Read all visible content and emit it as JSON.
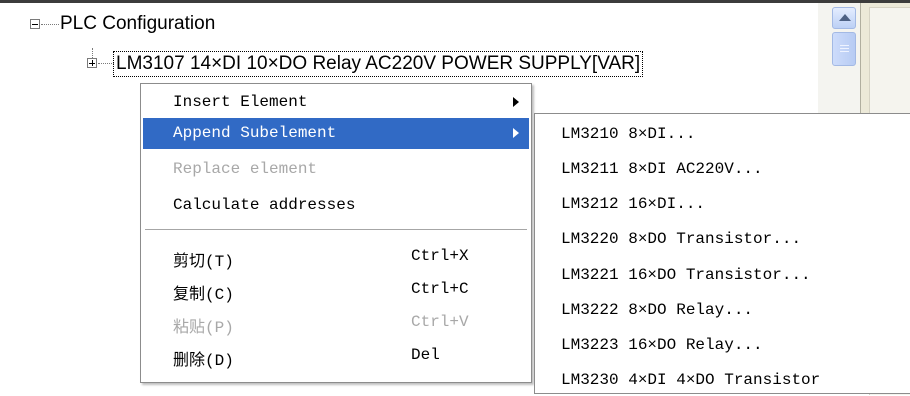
{
  "tree": {
    "root_label": "PLC Configuration",
    "child_label": "LM3107 14×DI 10×DO Relay AC220V POWER SUPPLY[VAR]"
  },
  "context_menu": {
    "items": [
      {
        "label": "Insert Element",
        "submenu": true,
        "state": "normal"
      },
      {
        "label": "Append Subelement",
        "submenu": true,
        "state": "highlighted"
      },
      {
        "label": "Replace element",
        "submenu": false,
        "state": "disabled"
      },
      {
        "label": "Calculate addresses",
        "submenu": false,
        "state": "normal"
      },
      {
        "label": "剪切(T)",
        "shortcut": "Ctrl+X",
        "state": "normal"
      },
      {
        "label": "复制(C)",
        "shortcut": "Ctrl+C",
        "state": "normal"
      },
      {
        "label": "粘贴(P)",
        "shortcut": "Ctrl+V",
        "state": "disabled"
      },
      {
        "label": "删除(D)",
        "shortcut": "Del",
        "state": "normal"
      }
    ]
  },
  "submenu": {
    "items": [
      "LM3210 8×DI...",
      "LM3211 8×DI AC220V...",
      "LM3212 16×DI...",
      "LM3220 8×DO Transistor...",
      "LM3221 16×DO Transistor...",
      "LM3222 8×DO Relay...",
      "LM3223 16×DO Relay...",
      "LM3230 4×DI 4×DO Transistor"
    ]
  },
  "colors": {
    "highlight": "#316ac5",
    "disabled_text": "#a8a8a8",
    "scrollbar_blue": "#bcd0f5"
  },
  "icons": [
    "minus-box-icon",
    "plus-box-icon",
    "chevron-up-icon",
    "submenu-arrow-icon"
  ]
}
